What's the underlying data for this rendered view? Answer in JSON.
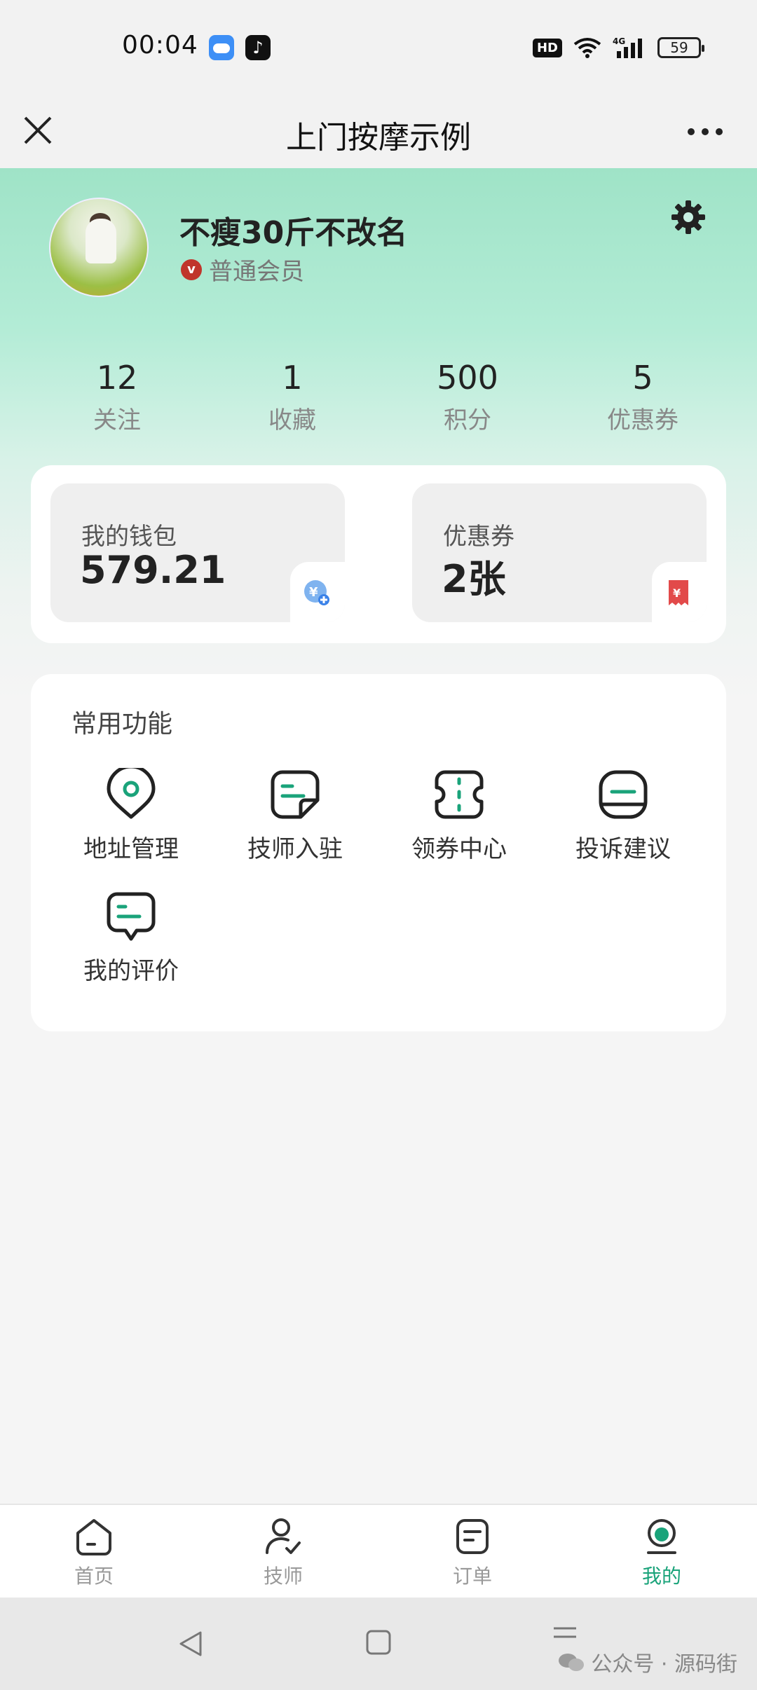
{
  "status_bar": {
    "time": "00:04",
    "hd": "HD",
    "battery": "59"
  },
  "nav": {
    "title": "上门按摩示例"
  },
  "profile": {
    "name": "不瘦30斤不改名",
    "member_level": "普通会员"
  },
  "stats": [
    {
      "value": "12",
      "label": "关注"
    },
    {
      "value": "1",
      "label": "收藏"
    },
    {
      "value": "500",
      "label": "积分"
    },
    {
      "value": "5",
      "label": "优惠券"
    }
  ],
  "wallet": {
    "title": "我的钱包",
    "value": "579.21"
  },
  "coupon": {
    "title": "优惠券",
    "value": "2张"
  },
  "functions": {
    "title": "常用功能",
    "items": [
      {
        "label": "地址管理",
        "icon": "location-pin-icon"
      },
      {
        "label": "技师入驻",
        "icon": "note-icon"
      },
      {
        "label": "领券中心",
        "icon": "ticket-icon"
      },
      {
        "label": "投诉建议",
        "icon": "feedback-icon"
      },
      {
        "label": "我的评价",
        "icon": "comment-icon"
      }
    ]
  },
  "tabs": [
    {
      "label": "首页",
      "icon": "home-icon"
    },
    {
      "label": "技师",
      "icon": "technician-icon"
    },
    {
      "label": "订单",
      "icon": "order-icon"
    },
    {
      "label": "我的",
      "icon": "profile-icon",
      "active": true
    }
  ],
  "watermark": "公众号 · 源码街",
  "colors": {
    "accent": "#1aa37a",
    "header_gradient_top": "#9fe3c7",
    "coupon_red": "#e24a4a"
  }
}
